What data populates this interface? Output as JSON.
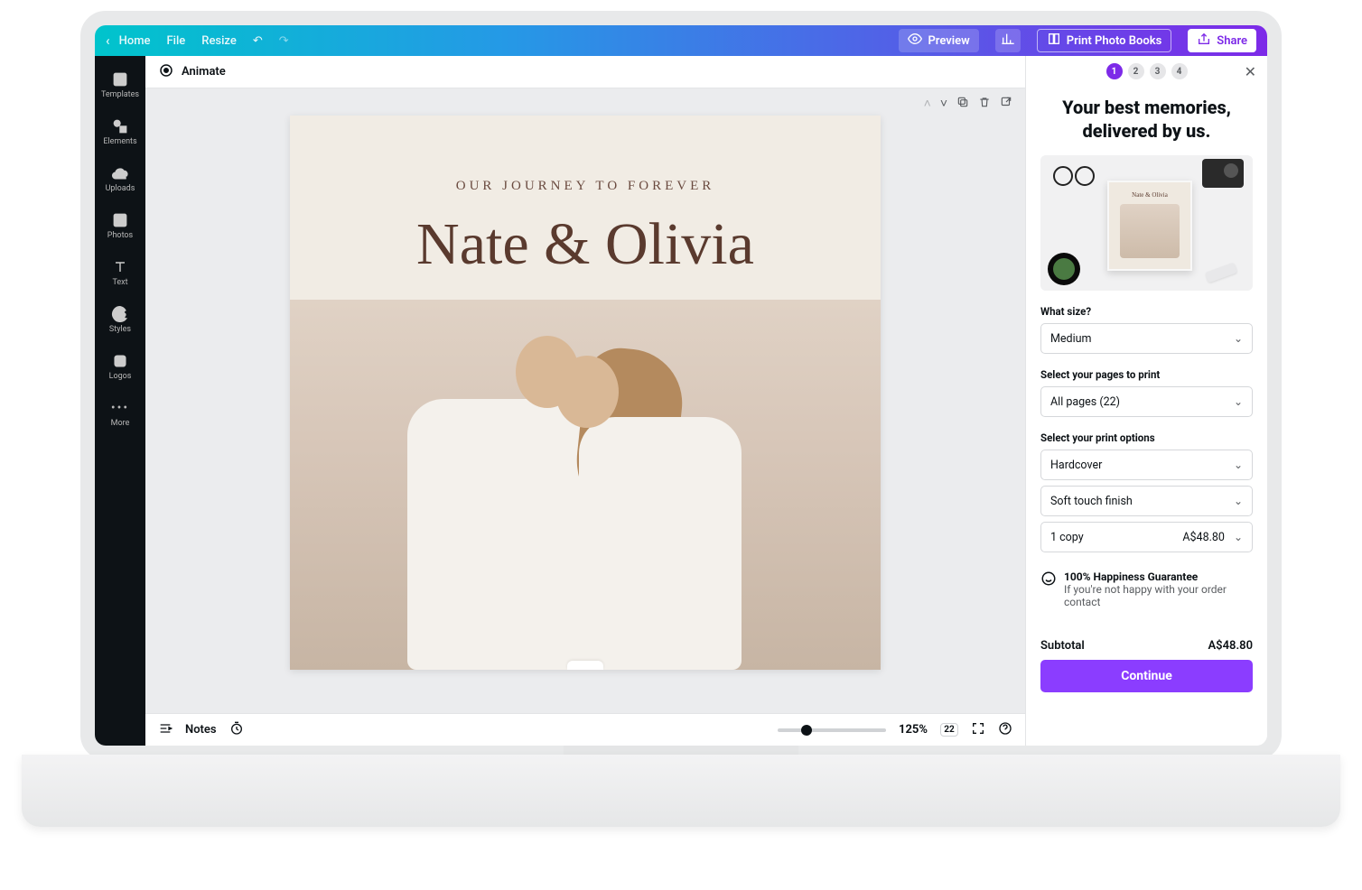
{
  "topbar": {
    "home": "Home",
    "file": "File",
    "resize": "Resize",
    "preview": "Preview",
    "print_photo_books": "Print Photo Books",
    "share": "Share"
  },
  "rail": {
    "templates": "Templates",
    "elements": "Elements",
    "uploads": "Uploads",
    "photos": "Photos",
    "text": "Text",
    "styles": "Styles",
    "logos": "Logos",
    "more": "More"
  },
  "context": {
    "animate": "Animate"
  },
  "canvas": {
    "subtitle": "OUR JOURNEY TO FOREVER",
    "title": "Nate & Olivia"
  },
  "bottombar": {
    "notes": "Notes",
    "zoom": "125%",
    "page_count": "22"
  },
  "panel": {
    "steps": [
      "1",
      "2",
      "3",
      "4"
    ],
    "active_step": "1",
    "headline_l1": "Your best memories,",
    "headline_l2": "delivered by us.",
    "book_title": "Nate & Olivia",
    "size_label": "What size?",
    "size_value": "Medium",
    "pages_label": "Select your pages to print",
    "pages_value": "All pages (22)",
    "options_label": "Select your print options",
    "cover_value": "Hardcover",
    "finish_value": "Soft touch finish",
    "qty_value": "1 copy",
    "qty_price": "A$48.80",
    "guarantee_title": "100% Happiness Guarantee",
    "guarantee_sub": "If you're not happy with your order contact",
    "subtotal_label": "Subtotal",
    "subtotal_value": "A$48.80",
    "continue": "Continue"
  }
}
